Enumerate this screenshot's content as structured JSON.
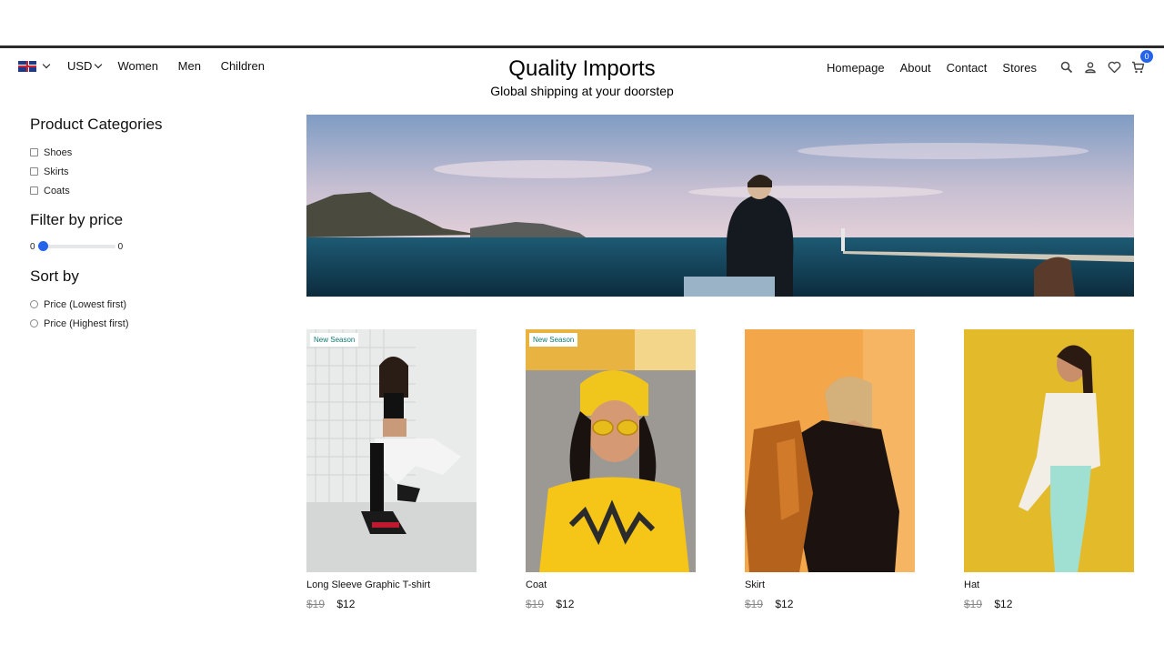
{
  "header": {
    "flag_icon": "uk-flag-icon",
    "currency": "USD",
    "nav_left": [
      "Women",
      "Men",
      "Children"
    ],
    "title": "Quality Imports",
    "subtitle": "Global shipping at your doorstep",
    "nav_right": [
      "Homepage",
      "About",
      "Contact",
      "Stores"
    ],
    "icons": [
      "search-icon",
      "user-icon",
      "heart-icon",
      "cart-icon"
    ],
    "cart_count": "0"
  },
  "sidebar": {
    "categories_title": "Product Categories",
    "categories": [
      "Shoes",
      "Skirts",
      "Coats"
    ],
    "price_title": "Filter by price",
    "price_min": "0",
    "price_max": "0",
    "price_level": 0,
    "sort_title": "Sort by",
    "sort_options": [
      "Price (Lowest first)",
      "Price (Highest first)"
    ]
  },
  "products": [
    {
      "name": "Long Sleeve Graphic T-shirt",
      "old_price": "$19",
      "price": "$12",
      "tag": "New Season"
    },
    {
      "name": "Coat",
      "old_price": "$19",
      "price": "$12",
      "tag": "New Season"
    },
    {
      "name": "Skirt",
      "old_price": "$19",
      "price": "$12",
      "tag": ""
    },
    {
      "name": "Hat",
      "old_price": "$19",
      "price": "$12",
      "tag": ""
    }
  ],
  "colors": {
    "accent": "#2563eb",
    "tag_text": "#0f766e"
  }
}
